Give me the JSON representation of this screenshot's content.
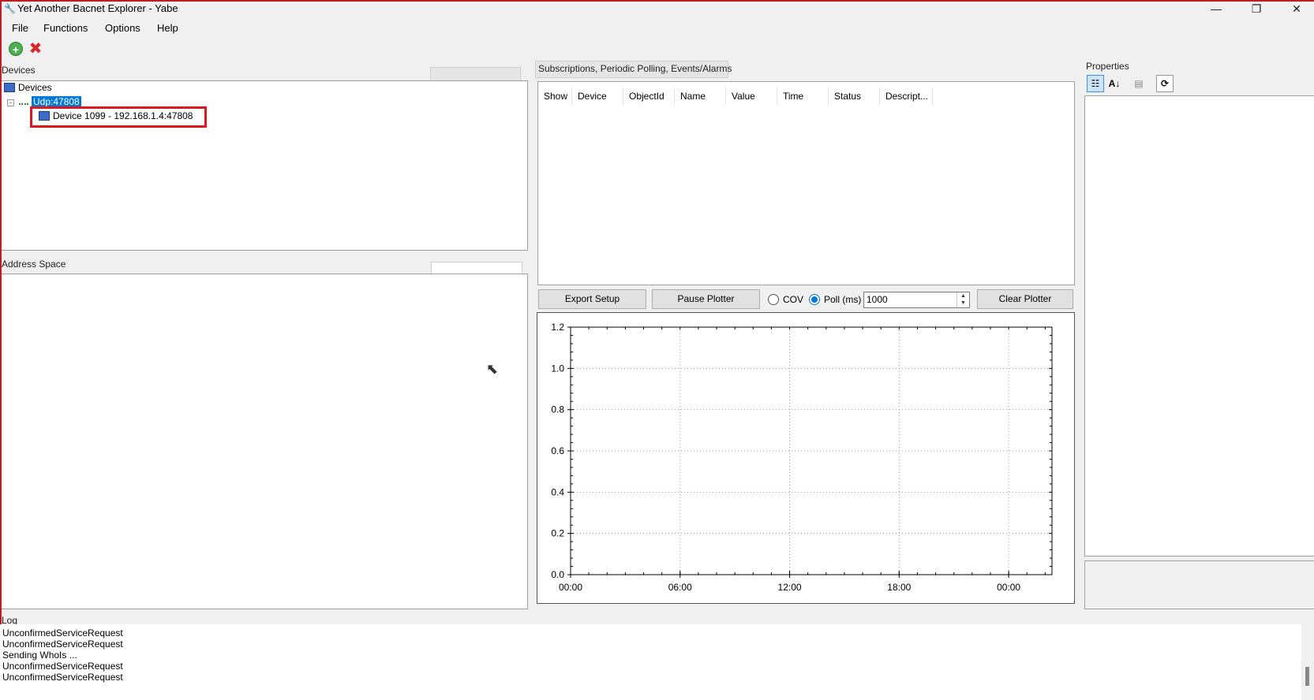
{
  "window": {
    "title": "Yet Another Bacnet Explorer - Yabe",
    "minimize": "—",
    "restore": "❐",
    "close": "✕"
  },
  "menu": {
    "items": [
      "File",
      "Functions",
      "Options",
      "Help"
    ]
  },
  "toolbar": {
    "add_icon": "add-device-icon",
    "delete_icon": "delete-device-icon"
  },
  "devices": {
    "panel_label": "Devices",
    "root_label": "Devices",
    "transport_label": "Udp:47808",
    "device_label": "Device 1099 - 192.168.1.4:47808"
  },
  "address_space": {
    "panel_label": "Address Space"
  },
  "subscriptions": {
    "panel_label": "Subscriptions, Periodic Polling, Events/Alarms",
    "columns": [
      "Show",
      "Device",
      "ObjectId",
      "Name",
      "Value",
      "Time",
      "Status",
      "Descript..."
    ]
  },
  "controls": {
    "export_setup": "Export Setup",
    "pause_plotter": "Pause Plotter",
    "cov_label": "COV",
    "poll_label": "Poll (ms)",
    "poll_value": "1000",
    "clear_plotter": "Clear Plotter",
    "selected_mode": "Poll (ms)"
  },
  "properties": {
    "panel_label": "Properties"
  },
  "log": {
    "panel_label": "Log",
    "lines": [
      "UnconfirmedServiceRequest",
      "UnconfirmedServiceRequest",
      "Sending WhoIs ...",
      "UnconfirmedServiceRequest",
      "UnconfirmedServiceRequest"
    ]
  },
  "chart_data": {
    "type": "line",
    "title": "",
    "xlabel": "",
    "ylabel": "",
    "x_tick_labels": [
      "00:00",
      "06:00",
      "12:00",
      "18:00",
      "00:00"
    ],
    "y_ticks": [
      0.0,
      0.2,
      0.4,
      0.6,
      0.8,
      1.0,
      1.2
    ],
    "y_tick_labels": [
      "0.0",
      "0.2",
      "0.4",
      "0.6",
      "0.8",
      "1.0",
      "1.2"
    ],
    "ylim": [
      0,
      1.2
    ],
    "grid": true,
    "series": []
  }
}
